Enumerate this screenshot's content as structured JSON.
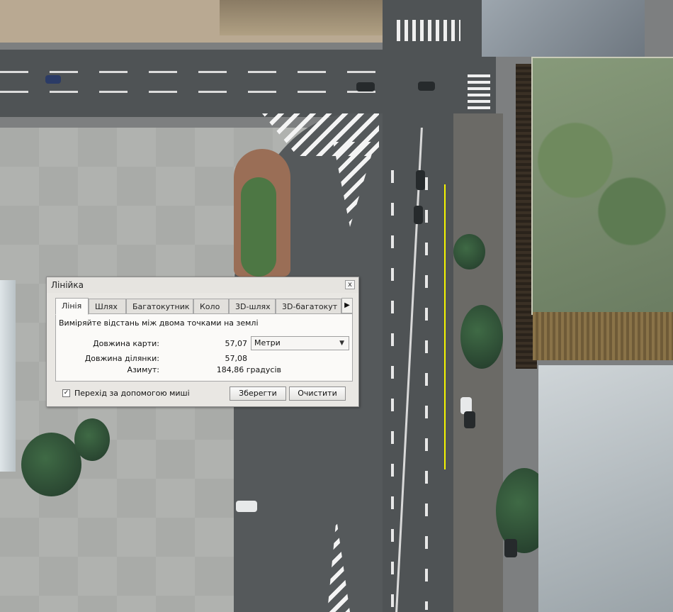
{
  "dialog": {
    "title": "Лінійка",
    "close_symbol": "x",
    "tabs": [
      {
        "label": "Лінія",
        "active": true
      },
      {
        "label": "Шлях",
        "active": false
      },
      {
        "label": "Багатокутник",
        "active": false
      },
      {
        "label": "Коло",
        "active": false
      },
      {
        "label": "3D-шлях",
        "active": false
      },
      {
        "label": "3D-багатокут",
        "active": false
      }
    ],
    "tab_scroll_symbol": "▶",
    "description": "Виміряйте відстань між двома точками на землі",
    "map_length_label": "Довжина карти:",
    "map_length_value": "57,07",
    "units_selected": "Метри",
    "units_arrow": "▼",
    "segment_length_label": "Довжина ділянки:",
    "segment_length_value": "57,08",
    "azimuth_label": "Азимут:",
    "azimuth_value": "184,86 градусів",
    "mouse_nav_label": "Перехід за допомогою миші",
    "mouse_nav_checked": true,
    "check_mark": "✓",
    "save_label": "Зберегти",
    "clear_label": "Очистити"
  },
  "colors": {
    "measure_line": "#f5f500",
    "dialog_bg": "#e9e7e3"
  }
}
